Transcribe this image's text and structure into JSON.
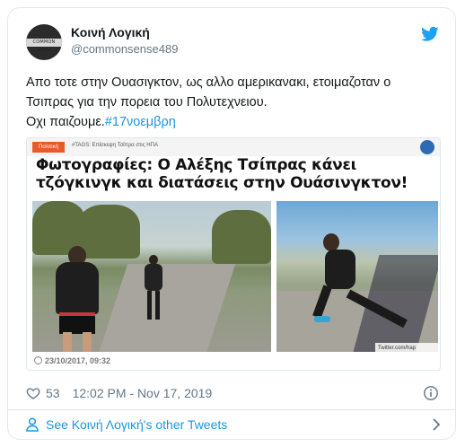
{
  "author": {
    "name": "Κοινή Λογική",
    "handle": "@commonsense489",
    "avatar_text": "COMMON SENSE"
  },
  "tweet": {
    "line1": "Απο τοτε στην Ουασιγκτον, ως αλλο αμερικανακι, ετοιμαζοταν ο Τσιπρας για την πορεια του Πολυτεχνειου.",
    "line2_prefix": "Οχι παιζουμε.",
    "hashtag": "#17νοεμβρη"
  },
  "media": {
    "category_tag": "Πολιτική",
    "tags_text": "#TAGS: Επίσκεψη Τσίπρα στις ΗΠΑ",
    "headline": "Φωτογραφίες: Ο Αλέξης Τσίπρας κάνει τζόγκινγκ και διατάσεις στην Ουάσινγκτον!",
    "credit": "Twitter.com/hap",
    "date": "23/10/2017, 09:32"
  },
  "meta": {
    "likes": "53",
    "timestamp": "12:02 PM - Nov 17, 2019"
  },
  "footer": {
    "more_tweets_label": "See Κοινή Λογική's other Tweets"
  },
  "colors": {
    "link": "#1b95e0",
    "secondary_text": "#657786",
    "border": "#e1e8ed"
  },
  "icons": [
    "twitter-bird-icon",
    "heart-icon",
    "info-icon",
    "person-icon",
    "chevron-right-icon"
  ]
}
